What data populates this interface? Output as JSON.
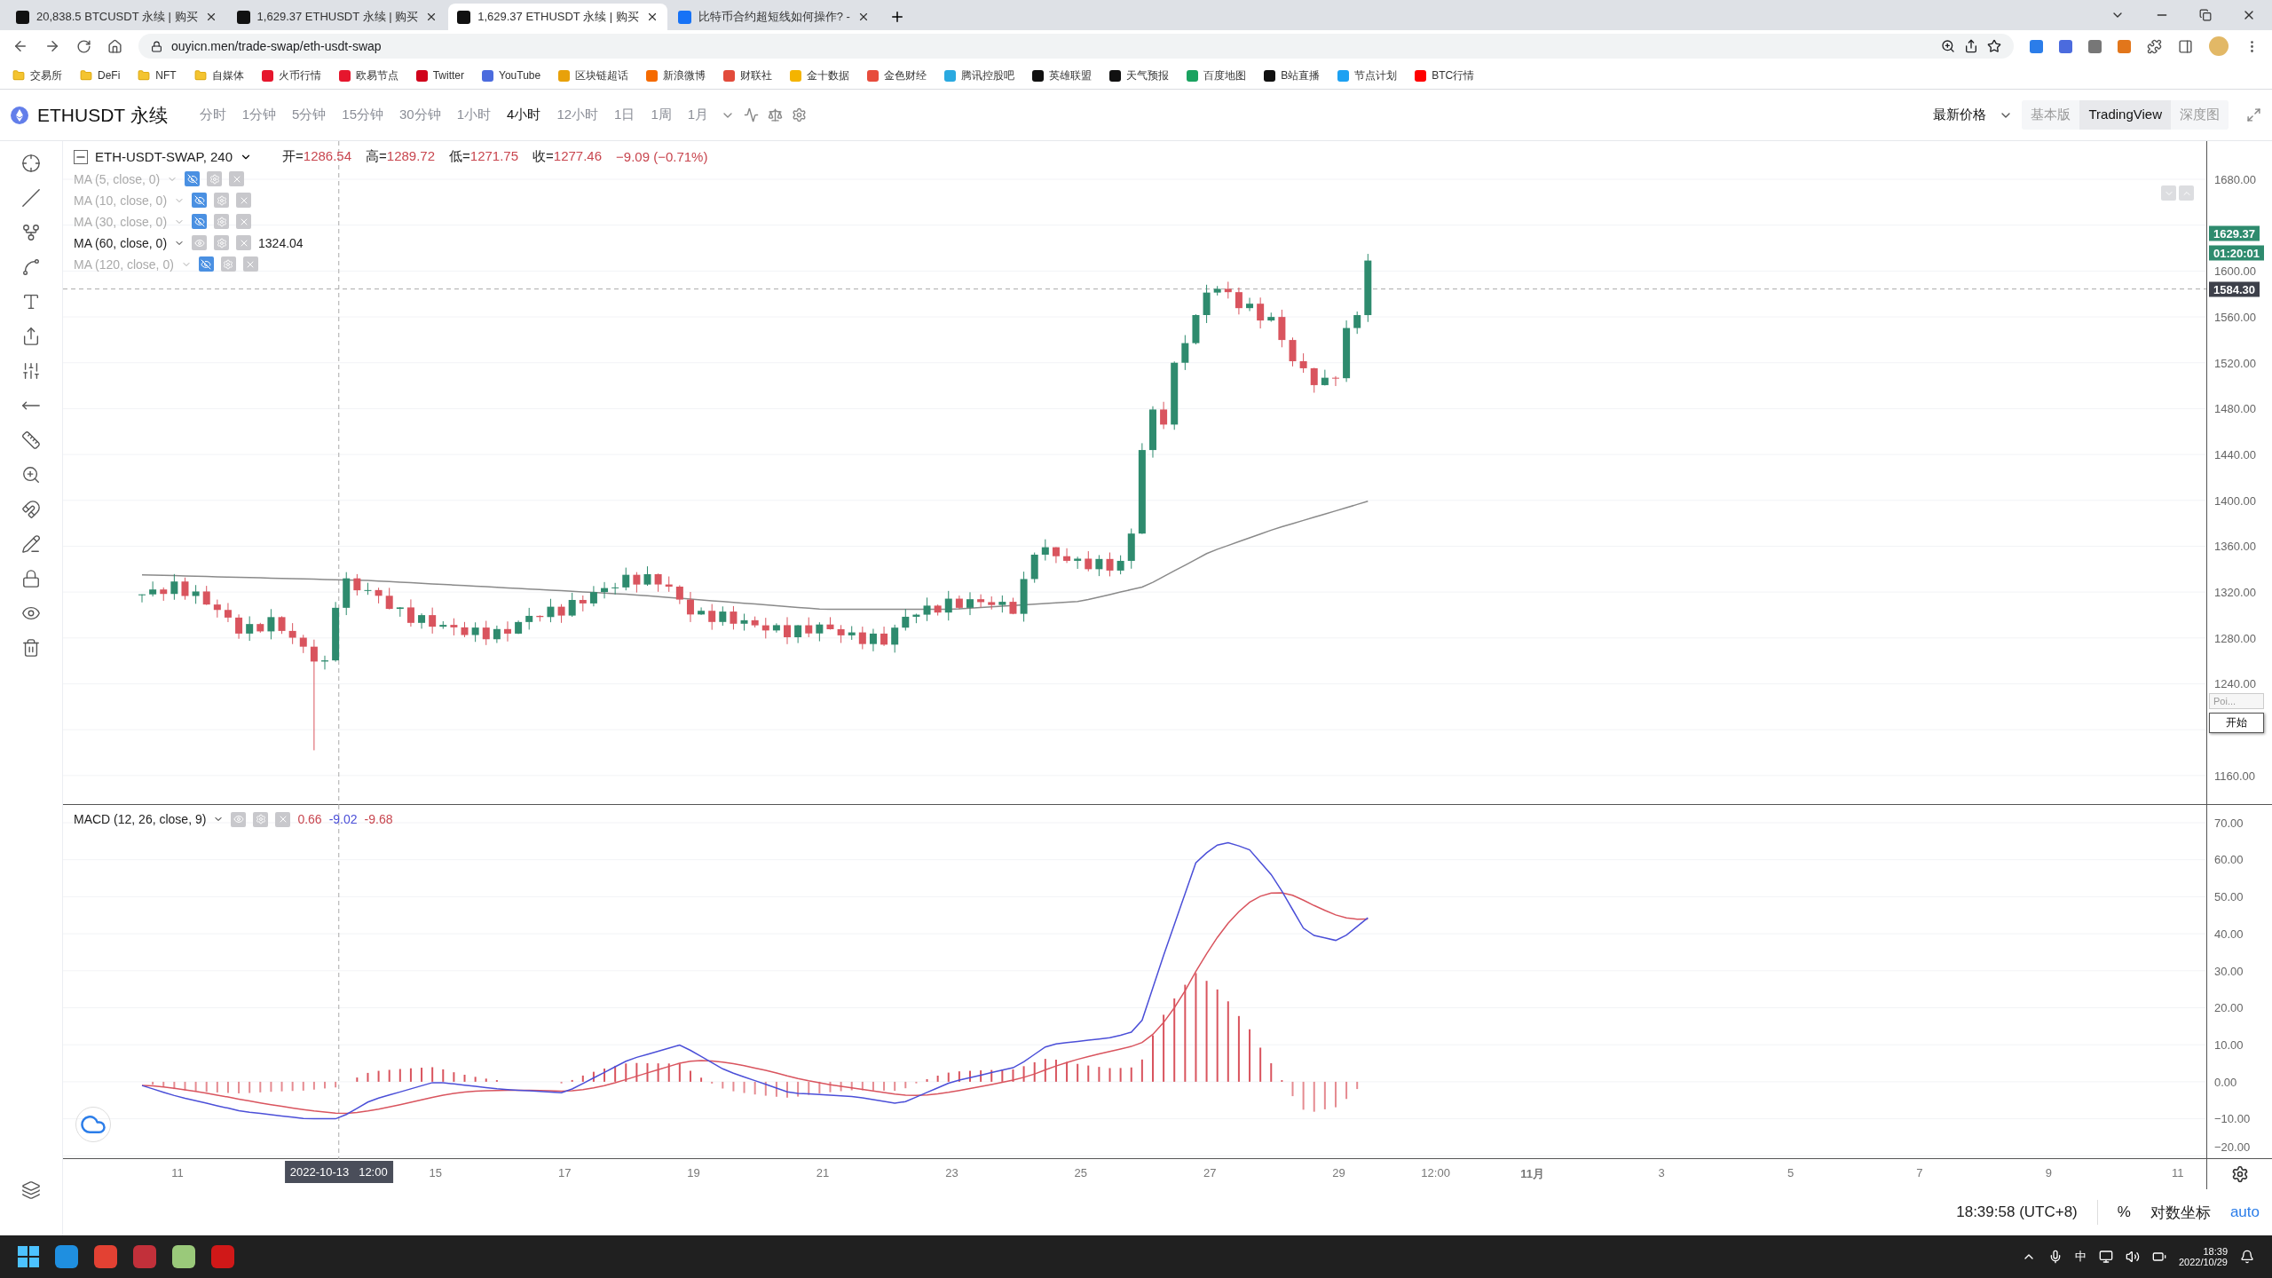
{
  "browser": {
    "tabs": [
      {
        "title": "20,838.5 BTCUSDT 永续 | 购买",
        "selected": false,
        "kind": "exchange"
      },
      {
        "title": "1,629.37 ETHUSDT 永续 | 购买",
        "selected": false,
        "kind": "exchange"
      },
      {
        "title": "1,629.37 ETHUSDT 永续 | 购买",
        "selected": true,
        "kind": "exchange"
      },
      {
        "title": "比特币合约超短线如何操作? -",
        "selected": false,
        "kind": "zhihu"
      }
    ],
    "url": "ouyicn.men/trade-swap/eth-usdt-swap",
    "bookmarks": [
      {
        "label": "交易所",
        "kind": "folder"
      },
      {
        "label": "DeFi",
        "kind": "folder"
      },
      {
        "label": "NFT",
        "kind": "folder"
      },
      {
        "label": "自媒体",
        "kind": "folder"
      },
      {
        "label": "火币行情",
        "kind": "site"
      },
      {
        "label": "欧易节点",
        "kind": "site"
      },
      {
        "label": "Twitter",
        "kind": "site"
      },
      {
        "label": "YouTube",
        "kind": "site"
      },
      {
        "label": "区块链超话",
        "kind": "site"
      },
      {
        "label": "新浪微博",
        "kind": "site"
      },
      {
        "label": "财联社",
        "kind": "site"
      },
      {
        "label": "金十数据",
        "kind": "site"
      },
      {
        "label": "金色财经",
        "kind": "site"
      },
      {
        "label": "腾讯控股吧",
        "kind": "site"
      },
      {
        "label": "英雄联盟",
        "kind": "site"
      },
      {
        "label": "天气预报",
        "kind": "site"
      },
      {
        "label": "百度地图",
        "kind": "site"
      },
      {
        "label": "B站直播",
        "kind": "site"
      },
      {
        "label": "节点计划",
        "kind": "site"
      },
      {
        "label": "BTC行情",
        "kind": "site"
      }
    ]
  },
  "toolbar": {
    "symbol": "ETHUSDT 永续",
    "intervals": [
      {
        "label": "分时",
        "selected": false
      },
      {
        "label": "1分钟",
        "selected": false
      },
      {
        "label": "5分钟",
        "selected": false
      },
      {
        "label": "15分钟",
        "selected": false
      },
      {
        "label": "30分钟",
        "selected": false
      },
      {
        "label": "1小时",
        "selected": false
      },
      {
        "label": "4小时",
        "selected": true
      },
      {
        "label": "12小时",
        "selected": false
      },
      {
        "label": "1日",
        "selected": false
      },
      {
        "label": "1周",
        "selected": false
      },
      {
        "label": "1月",
        "selected": false
      }
    ],
    "price_type": "最新价格",
    "views": [
      {
        "label": "基本版",
        "selected": false
      },
      {
        "label": "TradingView",
        "selected": true
      },
      {
        "label": "深度图",
        "selected": false
      }
    ]
  },
  "chart": {
    "title": "ETH-USDT-SWAP, 240",
    "ohlc": [
      {
        "label": "开=",
        "value": "1286.54"
      },
      {
        "label": "高=",
        "value": "1289.72"
      },
      {
        "label": "低=",
        "value": "1271.75"
      },
      {
        "label": "收=",
        "value": "1277.46"
      }
    ],
    "change": "−9.09 (−0.71%)",
    "indicators": [
      {
        "label": "MA (5, close, 0)",
        "visible": false
      },
      {
        "label": "MA (10, close, 0)",
        "visible": false
      },
      {
        "label": "MA (30, close, 0)",
        "visible": false
      },
      {
        "label": "MA (60, close, 0)",
        "visible": true,
        "value": "1324.04"
      },
      {
        "label": "MA (120, close, 0)",
        "visible": false
      }
    ],
    "price_ticks": [
      "1680.00",
      "1600.00",
      "1560.00",
      "1520.00",
      "1480.00",
      "1440.00",
      "1400.00",
      "1360.00",
      "1320.00",
      "1280.00",
      "1240.00",
      "1160.00"
    ],
    "last_price": "1629.37",
    "countdown": "01:20:01",
    "crosshair_price": "1584.30",
    "popup": {
      "field": "Poi...",
      "button": "开始"
    },
    "macd": {
      "label": "MACD (12, 26, close, 9)",
      "values": [
        "0.66",
        "-9.02",
        "-9.68"
      ],
      "ticks": [
        "70.00",
        "60.00",
        "50.00",
        "40.00",
        "30.00",
        "20.00",
        "10.00",
        "0.00",
        "−10.00",
        "−20.00"
      ]
    },
    "x_ticks": [
      {
        "label": "11",
        "bold": false
      },
      {
        "label": "15",
        "bold": false
      },
      {
        "label": "17",
        "bold": false
      },
      {
        "label": "19",
        "bold": false
      },
      {
        "label": "21",
        "bold": false
      },
      {
        "label": "23",
        "bold": false
      },
      {
        "label": "25",
        "bold": false
      },
      {
        "label": "27",
        "bold": false
      },
      {
        "label": "29",
        "bold": false
      },
      {
        "label": "12:00",
        "bold": false
      },
      {
        "label": "11月",
        "bold": true
      },
      {
        "label": "3",
        "bold": false
      },
      {
        "label": "5",
        "bold": false
      },
      {
        "label": "7",
        "bold": false
      },
      {
        "label": "9",
        "bold": false
      },
      {
        "label": "11",
        "bold": false
      }
    ],
    "crosshair_time": "2022-10-13   12:00"
  },
  "footer": {
    "time": "18:39:58 (UTC+8)",
    "percent": "%",
    "log_scale": "对数坐标",
    "auto": "auto"
  },
  "taskbar": {
    "ime": "中",
    "time": "18:39",
    "date": "2022/10/29"
  }
}
